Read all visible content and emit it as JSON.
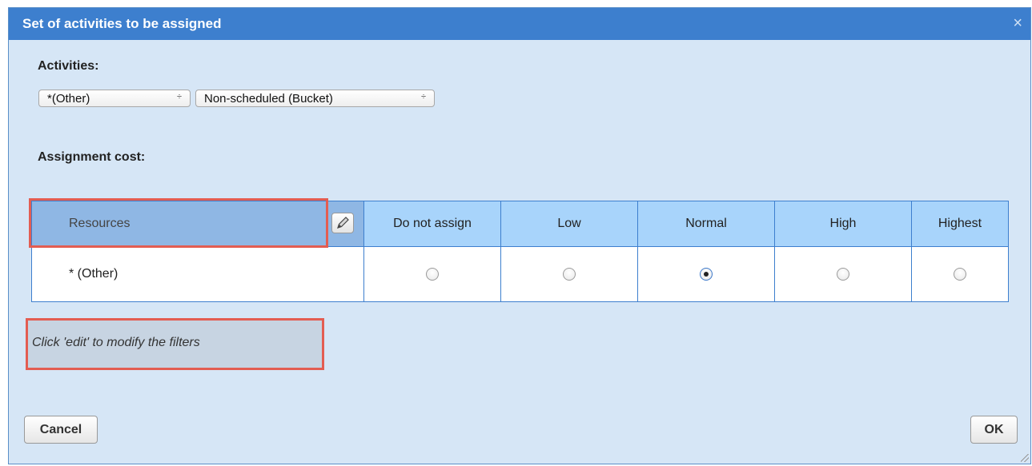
{
  "dialog": {
    "title": "Set of activities to be assigned",
    "close_glyph": "×"
  },
  "activities": {
    "label": "Activities:",
    "select1_value": "*(Other)",
    "select2_value": "Non-scheduled (Bucket)",
    "select_arrow": "÷"
  },
  "assignment": {
    "label": "Assignment cost:"
  },
  "grid": {
    "columns": [
      "Resources",
      "Do not assign",
      "Low",
      "Normal",
      "High",
      "Highest"
    ],
    "rows": [
      {
        "name": "* (Other)",
        "selected": "Normal"
      }
    ]
  },
  "filters_hint": "Click 'edit' to modify the filters",
  "buttons": {
    "cancel": "Cancel",
    "ok": "OK"
  },
  "icons": {
    "edit": "pencil-icon",
    "close": "close-icon"
  },
  "colors": {
    "titlebar": "#3d7fce",
    "dialog_bg": "#d6e6f6",
    "header_bg": "#a8d4fb",
    "highlight": "#e35d52"
  }
}
